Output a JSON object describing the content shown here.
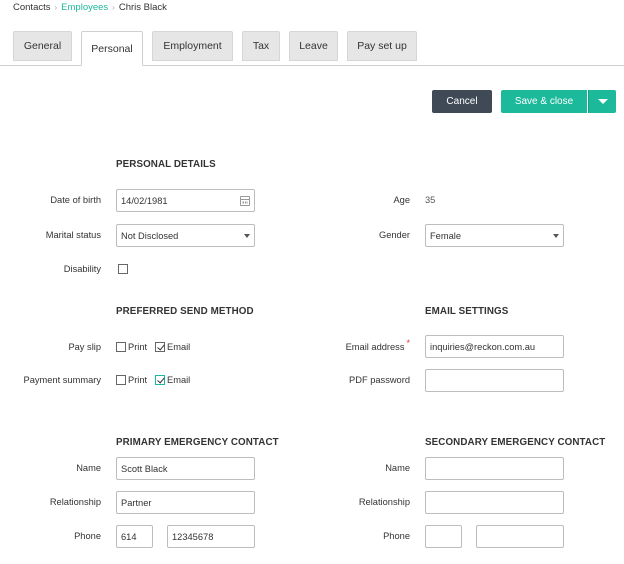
{
  "breadcrumb": {
    "root": "Contacts",
    "parent": "Employees",
    "current": "Chris Black"
  },
  "tabs": [
    {
      "label": "General"
    },
    {
      "label": "Personal"
    },
    {
      "label": "Employment"
    },
    {
      "label": "Tax"
    },
    {
      "label": "Leave"
    },
    {
      "label": "Pay set up"
    }
  ],
  "actions": {
    "cancel": "Cancel",
    "save_close": "Save & close"
  },
  "personal": {
    "title": "PERSONAL DETAILS",
    "dob_label": "Date of birth",
    "dob_value": "14/02/1981",
    "age_label": "Age",
    "age_value": "35",
    "marital_label": "Marital status",
    "marital_value": "Not Disclosed",
    "gender_label": "Gender",
    "gender_value": "Female",
    "disability_label": "Disability",
    "disability_checked": false
  },
  "send_method": {
    "title": "PREFERRED SEND METHOD",
    "payslip_label": "Pay slip",
    "summary_label": "Payment summary",
    "print_label": "Print",
    "email_label": "Email"
  },
  "email_settings": {
    "title": "EMAIL SETTINGS",
    "address_label": "Email address",
    "address_value": "inquiries@reckon.com.au",
    "required_mark": "*",
    "pdf_label": "PDF password",
    "pdf_value": ""
  },
  "primary_contact": {
    "title": "PRIMARY EMERGENCY CONTACT",
    "name_label": "Name",
    "name_value": "Scott Black",
    "relationship_label": "Relationship",
    "relationship_value": "Partner",
    "phone_label": "Phone",
    "phone_area": "614",
    "phone_number": "12345678"
  },
  "secondary_contact": {
    "title": "SECONDARY EMERGENCY CONTACT",
    "name_label": "Name",
    "name_value": "",
    "relationship_label": "Relationship",
    "relationship_value": "",
    "phone_label": "Phone",
    "phone_area": "",
    "phone_number": ""
  },
  "colors": {
    "accent": "#1cb99a",
    "cancel": "#3f4a56",
    "required": "#e0343a"
  }
}
